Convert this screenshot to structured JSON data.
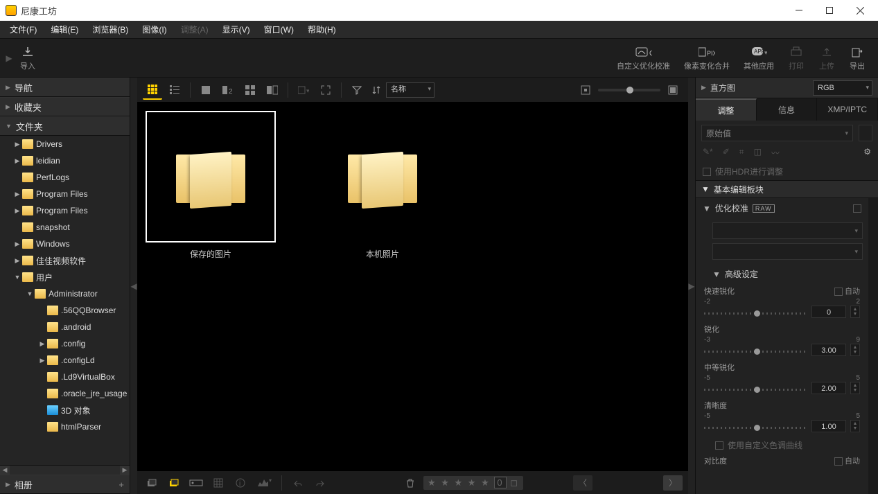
{
  "window": {
    "title": "尼康工坊"
  },
  "menu": {
    "file": "文件(F)",
    "edit": "编辑(E)",
    "browser": "浏览器(B)",
    "image": "图像(I)",
    "adjust": "调整(A)",
    "display": "显示(V)",
    "window": "窗口(W)",
    "help": "帮助(H)"
  },
  "toolbar_top": {
    "import": "导入",
    "custom_cal": "自定义优化校准",
    "pixel_merge": "像素变化合并",
    "other_apps": "其他应用",
    "print": "打印",
    "upload": "上传",
    "export": "导出"
  },
  "left": {
    "nav": "导航",
    "fav": "收藏夹",
    "folders": "文件夹",
    "album": "相册",
    "tree": [
      {
        "name": "Drivers",
        "depth": 1,
        "exp": "▶"
      },
      {
        "name": "leidian",
        "depth": 1,
        "exp": "▶"
      },
      {
        "name": "PerfLogs",
        "depth": 1,
        "exp": ""
      },
      {
        "name": "Program Files",
        "depth": 1,
        "exp": "▶"
      },
      {
        "name": "Program Files",
        "depth": 1,
        "exp": "▶"
      },
      {
        "name": "snapshot",
        "depth": 1,
        "exp": ""
      },
      {
        "name": "Windows",
        "depth": 1,
        "exp": "▶"
      },
      {
        "name": "佳佳视频软件",
        "depth": 1,
        "exp": "▶"
      },
      {
        "name": "用户",
        "depth": 1,
        "exp": "▼"
      },
      {
        "name": "Administrator",
        "depth": 2,
        "exp": "▼"
      },
      {
        "name": ".56QQBrowser",
        "depth": 3,
        "exp": ""
      },
      {
        "name": ".android",
        "depth": 3,
        "exp": ""
      },
      {
        "name": ".config",
        "depth": 3,
        "exp": "▶"
      },
      {
        "name": ".configLd",
        "depth": 3,
        "exp": "▶"
      },
      {
        "name": ".Ld9VirtualBox",
        "depth": 3,
        "exp": ""
      },
      {
        "name": ".oracle_jre_usage",
        "depth": 3,
        "exp": ""
      },
      {
        "name": "3D 对象",
        "depth": 3,
        "exp": "",
        "icon": "blue"
      },
      {
        "name": "htmlParser",
        "depth": 3,
        "exp": ""
      }
    ]
  },
  "center": {
    "sort_label": "名称",
    "items": [
      {
        "label": "保存的图片",
        "selected": true
      },
      {
        "label": "本机照片",
        "selected": false
      }
    ],
    "rating_count": "0"
  },
  "right": {
    "histogram": "直方图",
    "colorspace": "RGB",
    "tabs": {
      "adjust": "调整",
      "info": "信息",
      "xmp": "XMP/IPTC"
    },
    "preset": "原始值",
    "hdr_label": "使用HDR进行调整",
    "basic_editor": "基本编辑板块",
    "opt_cal": "优化校准",
    "raw_badge": "RAW",
    "advanced": "高级设定",
    "auto": "自动",
    "sliders": {
      "quick_sharpen": {
        "label": "快速锐化",
        "min": "-2",
        "max": "2",
        "val": "0"
      },
      "sharpen": {
        "label": "锐化",
        "min": "-3",
        "max": "9",
        "val": "3.00"
      },
      "mid_sharpen": {
        "label": "中等锐化",
        "min": "-5",
        "max": "5",
        "val": "2.00"
      },
      "clarity": {
        "label": "清晰度",
        "min": "-5",
        "max": "5",
        "val": "1.00"
      }
    },
    "custom_curve": "使用自定义色调曲线",
    "contrast": "对比度"
  }
}
